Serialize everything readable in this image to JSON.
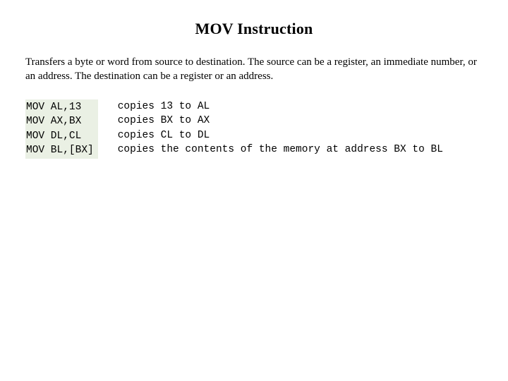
{
  "title": "MOV Instruction",
  "description": "Transfers a byte or word from source to destination.  The source can be a register, an immediate number, or an address.  The destination can be a register or an address.",
  "examples": {
    "code": "MOV AL,13\nMOV AX,BX\nMOV DL,CL\nMOV BL,[BX]",
    "explain": "copies 13 to AL\ncopies BX to AX\ncopies CL to DL\ncopies the contents of the memory at address BX to BL"
  }
}
